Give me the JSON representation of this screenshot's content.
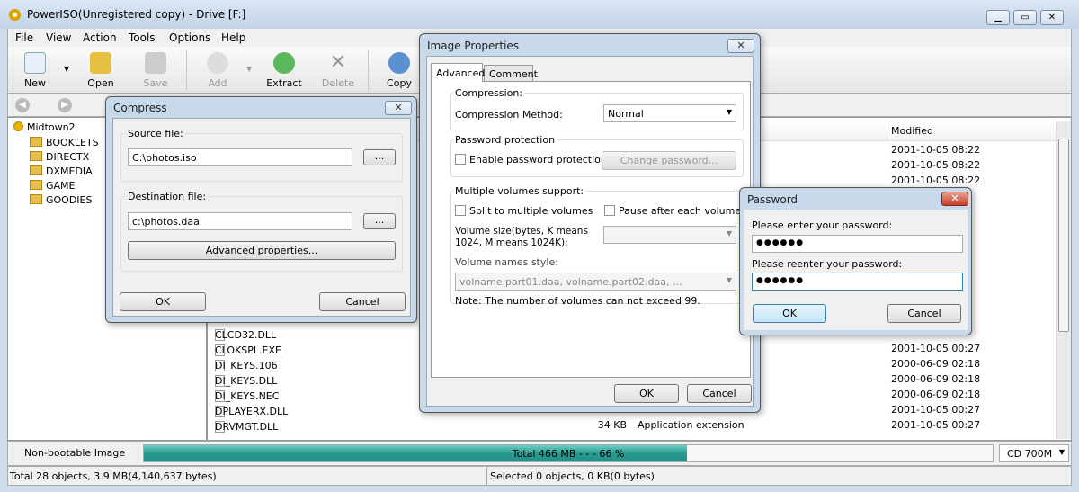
{
  "window": {
    "title": "PowerISO(Unregistered copy) - Drive [F:]",
    "minimize": "▁",
    "maximize": "▭",
    "close": "✕"
  },
  "menu": [
    "File",
    "View",
    "Action",
    "Tools",
    "Options",
    "Help"
  ],
  "toolbar": [
    {
      "label": "New",
      "enabled": true
    },
    {
      "label": "Open",
      "enabled": true
    },
    {
      "label": "Save",
      "enabled": false
    },
    {
      "label": "Add",
      "enabled": false
    },
    {
      "label": "Extract",
      "enabled": true
    },
    {
      "label": "Delete",
      "enabled": false
    },
    {
      "label": "Copy",
      "enabled": true
    }
  ],
  "tree": {
    "root": "Midtown2",
    "items": [
      "BOOKLETS",
      "DIRECTX",
      "DXMEDIA",
      "GAME",
      "GOODIES"
    ]
  },
  "list": {
    "header_modified": "Modified",
    "top_dates": [
      "2001-10-05 08:22",
      "2001-10-05 08:22",
      "2001-10-05 08:22"
    ],
    "rows": [
      {
        "name": "CLCD32.DLL",
        "size": "",
        "type": "",
        "modified": ""
      },
      {
        "name": "CLOKSPL.EXE",
        "size": "",
        "type": "",
        "modified": "2001-10-05 00:27"
      },
      {
        "name": "DI_KEYS.106",
        "size": "",
        "type": "",
        "modified": "2000-06-09 02:18"
      },
      {
        "name": "DI_KEYS.DLL",
        "size": "",
        "type": "",
        "modified": "2000-06-09 02:18"
      },
      {
        "name": "DI_KEYS.NEC",
        "size": "",
        "type": "",
        "modified": "2000-06-09 02:18"
      },
      {
        "name": "DPLAYERX.DLL",
        "size": "",
        "type": "",
        "modified": "2001-10-05 00:27"
      },
      {
        "name": "DRVMGT.DLL",
        "size": "34 KB",
        "type": "Application extension",
        "modified": "2001-10-05 00:27"
      }
    ]
  },
  "bottom": {
    "image_type": "Non-bootable Image",
    "progress_text": "Total  466 MB  - - -  66 %",
    "progress_percent": 66,
    "media": "CD 700M"
  },
  "status": {
    "left": "Total 28 objects, 3.9 MB(4,140,637 bytes)",
    "right": "Selected 0 objects, 0 KB(0 bytes)"
  },
  "compress": {
    "title": "Compress",
    "source_label": "Source file:",
    "source_value": "C:\\photos.iso",
    "dest_label": "Destination file:",
    "dest_value": "c:\\photos.daa",
    "browse": "...",
    "advanced": "Advanced properties...",
    "ok": "OK",
    "cancel": "Cancel"
  },
  "image_props": {
    "title": "Image Properties",
    "tabs": [
      "Advanced",
      "Comment"
    ],
    "compression_group": "Compression:",
    "method_label": "Compression Method:",
    "method_value": "Normal",
    "password_group": "Password protection",
    "enable_password": "Enable password protection",
    "change_password": "Change password...",
    "volumes_group": "Multiple volumes support:",
    "split": "Split to multiple volumes",
    "pause": "Pause after each volume",
    "volume_size_label": "Volume size(bytes, K means 1024, M means 1024K):",
    "volume_names_label": "Volume names style:",
    "volume_names_value": "volname.part01.daa, volname.part02.daa, ...",
    "note": "Note: The number of volumes can not exceed 99.",
    "ok": "OK",
    "cancel": "Cancel"
  },
  "password": {
    "title": "Password",
    "enter_label": "Please enter your password:",
    "enter_value": "●●●●●●",
    "reenter_label": "Please reenter your password:",
    "reenter_value": "●●●●●●",
    "ok": "OK",
    "cancel": "Cancel"
  },
  "colors": {
    "progress": "#2a9a90",
    "title_bg": "#c9d9ec"
  }
}
